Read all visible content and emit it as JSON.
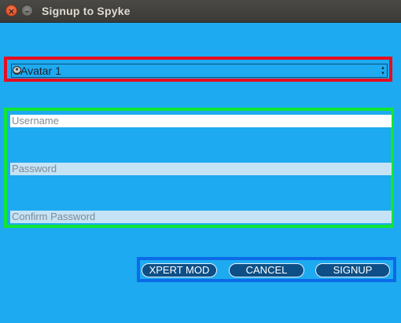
{
  "window": {
    "title": "Signup to Spyke",
    "close_glyph": "×",
    "minimize_glyph": "–"
  },
  "avatar": {
    "selected_label": "Avatar 1",
    "icon": "avatar-icon",
    "arrow_glyph": "▴\n▾"
  },
  "form": {
    "username": {
      "value": "",
      "placeholder": "Username"
    },
    "password": {
      "value": "",
      "placeholder": "Password"
    },
    "confirm_password": {
      "value": "",
      "placeholder": "Confirm Password"
    }
  },
  "buttons": {
    "expert_mode_label": "XPERT MOD",
    "cancel_label": "CANCEL",
    "signup_label": "SIGNUP"
  },
  "colors": {
    "background": "#1eaaf0",
    "avatar_border": "#e60d20",
    "credentials_border": "#10e635",
    "buttons_border": "#0a6ae8",
    "button_fill": "#0d4f86"
  }
}
